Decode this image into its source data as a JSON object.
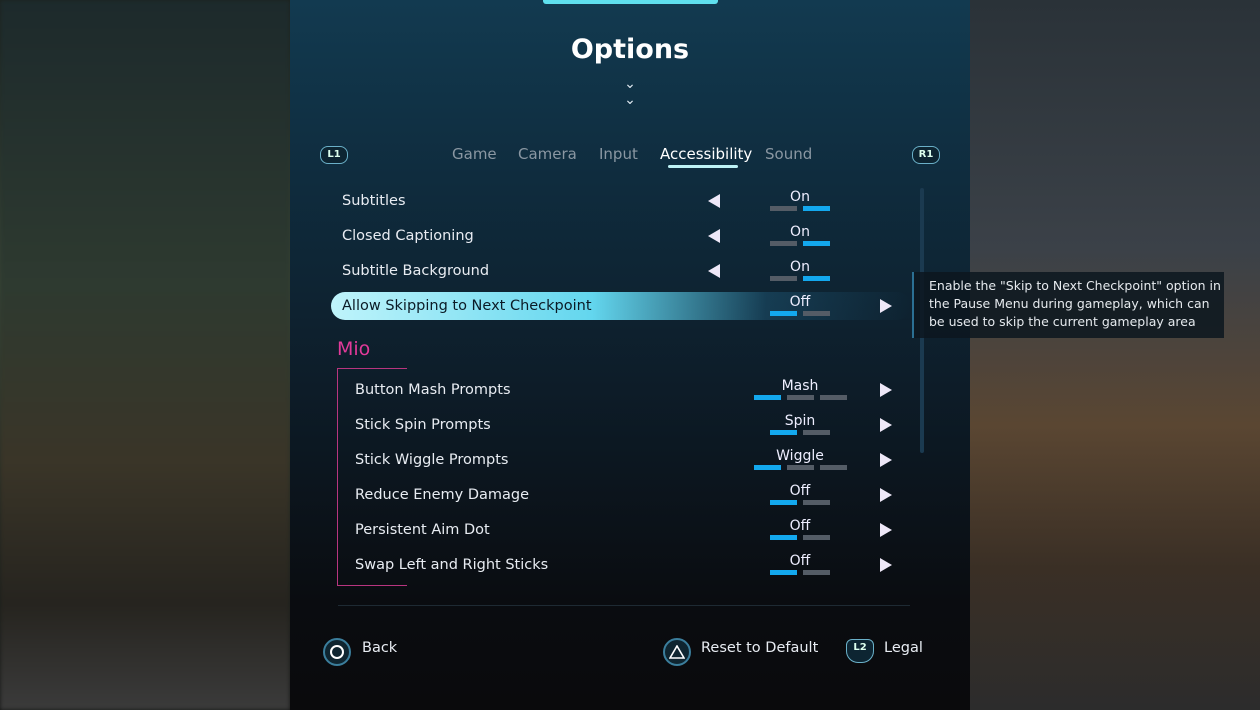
{
  "header": {
    "title": "Options"
  },
  "tabs": {
    "left_button": "L1",
    "right_button": "R1",
    "items": [
      {
        "label": "Game"
      },
      {
        "label": "Camera"
      },
      {
        "label": "Input"
      },
      {
        "label": "Accessibility",
        "active": true
      },
      {
        "label": "Sound"
      }
    ]
  },
  "settings": [
    {
      "label": "Subtitles",
      "value": "On",
      "options": 2,
      "selected": 2,
      "arrow": "left"
    },
    {
      "label": "Closed Captioning",
      "value": "On",
      "options": 2,
      "selected": 2,
      "arrow": "left"
    },
    {
      "label": "Subtitle Background",
      "value": "On",
      "options": 2,
      "selected": 2,
      "arrow": "left"
    },
    {
      "label": "Allow Skipping to Next Checkpoint",
      "value": "Off",
      "options": 2,
      "selected": 1,
      "arrow": "right",
      "highlighted": true
    }
  ],
  "section": {
    "title": "Mio",
    "color": "#e23a9a"
  },
  "mio_settings": [
    {
      "label": "Button Mash Prompts",
      "value": "Mash",
      "options": 3,
      "selected": 1
    },
    {
      "label": "Stick Spin Prompts",
      "value": "Spin",
      "options": 2,
      "selected": 1
    },
    {
      "label": "Stick Wiggle Prompts",
      "value": "Wiggle",
      "options": 3,
      "selected": 1
    },
    {
      "label": "Reduce Enemy Damage",
      "value": "Off",
      "options": 2,
      "selected": 1
    },
    {
      "label": "Persistent Aim Dot",
      "value": "Off",
      "options": 2,
      "selected": 1
    },
    {
      "label": "Swap Left and Right Sticks",
      "value": "Off",
      "options": 2,
      "selected": 1
    }
  ],
  "tooltip": {
    "text": "Enable the \"Skip to Next Checkpoint\" option in the Pause Menu during gameplay, which can be used to skip the current gameplay area"
  },
  "footer": {
    "back": "Back",
    "reset": "Reset to Default",
    "legal_button": "L2",
    "legal": "Legal"
  },
  "colors": {
    "accent": "#13a8ee",
    "highlight": "#63d6ee",
    "section": "#e23a9a"
  }
}
